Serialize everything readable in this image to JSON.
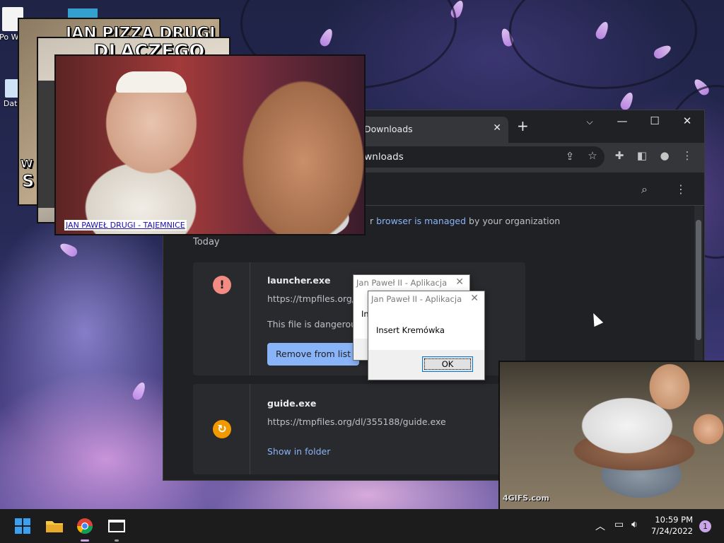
{
  "desktop": {
    "icons": [
      {
        "label": "Po Wat"
      },
      {
        "label": "Data"
      }
    ]
  },
  "chrome": {
    "tab_title": "Downloads",
    "address": "ownloads",
    "managed_prefix": "r ",
    "managed_link": "browser is managed",
    "managed_suffix": " by your organization",
    "section_today": "Today",
    "downloads": [
      {
        "name": "launcher.exe",
        "url": "https://tmpfiles.org/d",
        "warning": "This file is dangerous",
        "action": "Remove from list",
        "status_icon": "!"
      },
      {
        "name": "guide.exe",
        "url": "https://tmpfiles.org/dl/355188/guide.exe",
        "action": "Show in folder"
      }
    ]
  },
  "memes": {
    "top_title": "JAN PIZZA DRUGI",
    "second_title": "DLACZEGO",
    "left_w": "W",
    "left_s": "S",
    "pope_caption": "JAN PAWEŁ DRUGI - TAJEMNICE",
    "gif_watermark": "4GIFS.com"
  },
  "dialogs": [
    {
      "title": "Jan Paweł II - Aplikacja",
      "message": "In"
    },
    {
      "title": "Jan Paweł II - Aplikacja",
      "message": "Insert Kremówka",
      "button": "OK"
    }
  ],
  "taskbar": {
    "time": "10:59 PM",
    "date": "7/24/2022",
    "notification_count": "1"
  }
}
